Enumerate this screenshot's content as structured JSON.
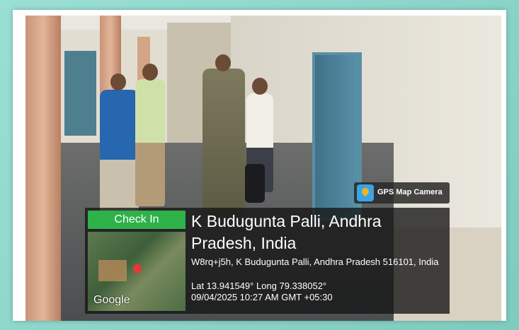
{
  "badge": {
    "label": "GPS Map Camera",
    "icon": "gps-map-camera-icon"
  },
  "checkin": {
    "label": "Check In"
  },
  "location": {
    "title": "K Budugunta Palli, Andhra Pradesh, India",
    "address": "W8rq+j5h, K Budugunta Palli, Andhra Pradesh 516101, India",
    "coords": "Lat 13.941549° Long 79.338052°",
    "datetime": "09/04/2025 10:27 AM GMT +05:30"
  },
  "map": {
    "brand": "Google"
  }
}
